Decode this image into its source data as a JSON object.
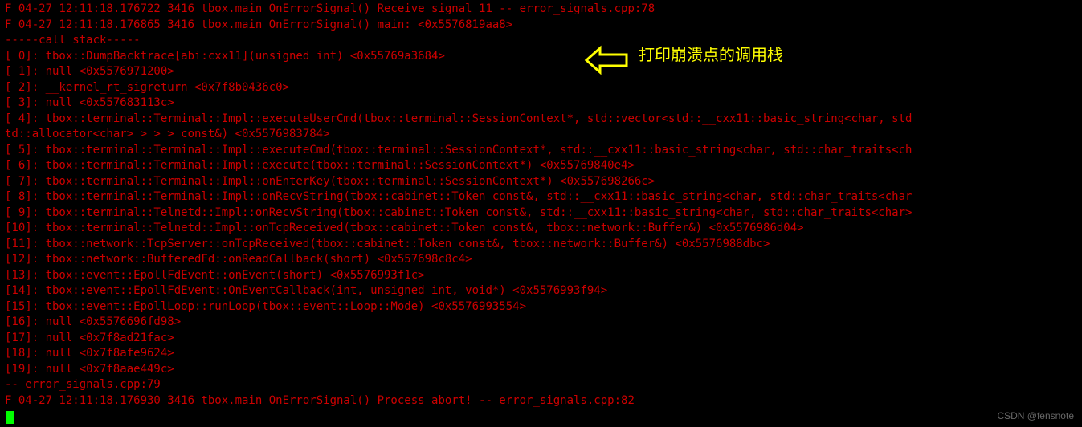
{
  "terminal": {
    "lines": [
      "F 04-27 12:11:18.176722 3416 tbox.main OnErrorSignal() Receive signal 11 -- error_signals.cpp:78",
      "F 04-27 12:11:18.176865 3416 tbox.main OnErrorSignal() main: <0x5576819aa8>",
      "-----call stack-----",
      "[ 0]: tbox::DumpBacktrace[abi:cxx11](unsigned int) <0x55769a3684>",
      "[ 1]: null <0x5576971200>",
      "[ 2]: __kernel_rt_sigreturn <0x7f8b0436c0>",
      "[ 3]: null <0x557683113c>",
      "[ 4]: tbox::terminal::Terminal::Impl::executeUserCmd(tbox::terminal::SessionContext*, std::vector<std::__cxx11::basic_string<char, std",
      "td::allocator<char> > > > const&) <0x5576983784>",
      "[ 5]: tbox::terminal::Terminal::Impl::executeCmd(tbox::terminal::SessionContext*, std::__cxx11::basic_string<char, std::char_traits<ch",
      "[ 6]: tbox::terminal::Terminal::Impl::execute(tbox::terminal::SessionContext*) <0x55769840e4>",
      "[ 7]: tbox::terminal::Terminal::Impl::onEnterKey(tbox::terminal::SessionContext*) <0x557698266c>",
      "[ 8]: tbox::terminal::Terminal::Impl::onRecvString(tbox::cabinet::Token const&, std::__cxx11::basic_string<char, std::char_traits<char",
      "[ 9]: tbox::terminal::Telnetd::Impl::onRecvString(tbox::cabinet::Token const&, std::__cxx11::basic_string<char, std::char_traits<char>",
      "[10]: tbox::terminal::Telnetd::Impl::onTcpReceived(tbox::cabinet::Token const&, tbox::network::Buffer&) <0x5576986d04>",
      "[11]: tbox::network::TcpServer::onTcpReceived(tbox::cabinet::Token const&, tbox::network::Buffer&) <0x5576988dbc>",
      "[12]: tbox::network::BufferedFd::onReadCallback(short) <0x557698c8c4>",
      "[13]: tbox::event::EpollFdEvent::onEvent(short) <0x5576993f1c>",
      "[14]: tbox::event::EpollFdEvent::OnEventCallback(int, unsigned int, void*) <0x5576993f94>",
      "[15]: tbox::event::EpollLoop::runLoop(tbox::event::Loop::Mode) <0x5576993554>",
      "[16]: null <0x5576696fd98>",
      "[17]: null <0x7f8ad21fac>",
      "[18]: null <0x7f8afe9624>",
      "[19]: null <0x7f8aae449c>",
      " -- error_signals.cpp:79",
      "F 04-27 12:11:18.176930 3416 tbox.main OnErrorSignal() Process abort! -- error_signals.cpp:82"
    ]
  },
  "annotation": {
    "text": "打印崩溃点的调用栈"
  },
  "watermark": {
    "text": "CSDN @fensnote"
  },
  "colors": {
    "bg": "#000000",
    "text": "#cc0000",
    "highlight": "#ffff00"
  }
}
